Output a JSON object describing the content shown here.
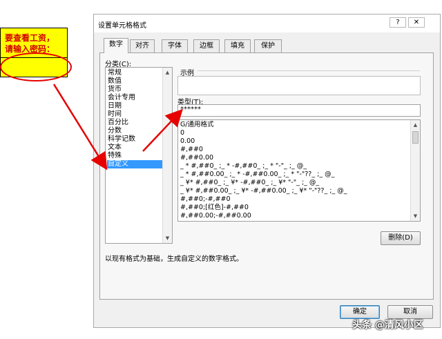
{
  "note": {
    "text": "要查看工资，\n请输入密码："
  },
  "dialog": {
    "title": "设置单元格格式",
    "help_button": "?",
    "close_button": "✕",
    "tabs": [
      {
        "label": "数字",
        "active": true
      },
      {
        "label": "对齐",
        "active": false
      },
      {
        "label": "字体",
        "active": false
      },
      {
        "label": "边框",
        "active": false
      },
      {
        "label": "填充",
        "active": false
      },
      {
        "label": "保护",
        "active": false
      }
    ],
    "category_label": "分类(C):",
    "categories": [
      "常规",
      "数值",
      "货币",
      "会计专用",
      "日期",
      "时间",
      "百分比",
      "分数",
      "科学记数",
      "文本",
      "特殊",
      "自定义"
    ],
    "selected_category": "自定义",
    "sample_label": "示例",
    "type_label": "类型(T):",
    "type_value": "******",
    "formats": [
      "G/通用格式",
      "0",
      "0.00",
      "#,##0",
      "#,##0.00",
      "_ * #,##0_ ;_ * -#,##0_ ;_ * \"-\"_ ;_ @_",
      "_ * #,##0.00_ ;_ * -#,##0.00_ ;_ * \"-\"??_ ;_ @_",
      "_ ¥* #,##0_ ;_ ¥* -#,##0_ ;_ ¥* \"-\"_ ;_ @_",
      "_ ¥* #,##0.00_ ;_ ¥* -#,##0.00_ ;_ ¥* \"-\"??_ ;_ @_",
      "#,##0;-#,##0",
      "#,##0;[红色]-#,##0",
      "#,##0.00;-#,##0.00"
    ],
    "delete_button": "删除(D)",
    "description": "以现有格式为基础，生成自定义的数字格式。",
    "ok_button": "确定",
    "cancel_button": "取消"
  },
  "watermark": "头条 @清风小区",
  "colors": {
    "note_bg": "#ffff00",
    "note_text": "#d40000",
    "arrow": "#e60000",
    "selection": "#3399ff"
  }
}
